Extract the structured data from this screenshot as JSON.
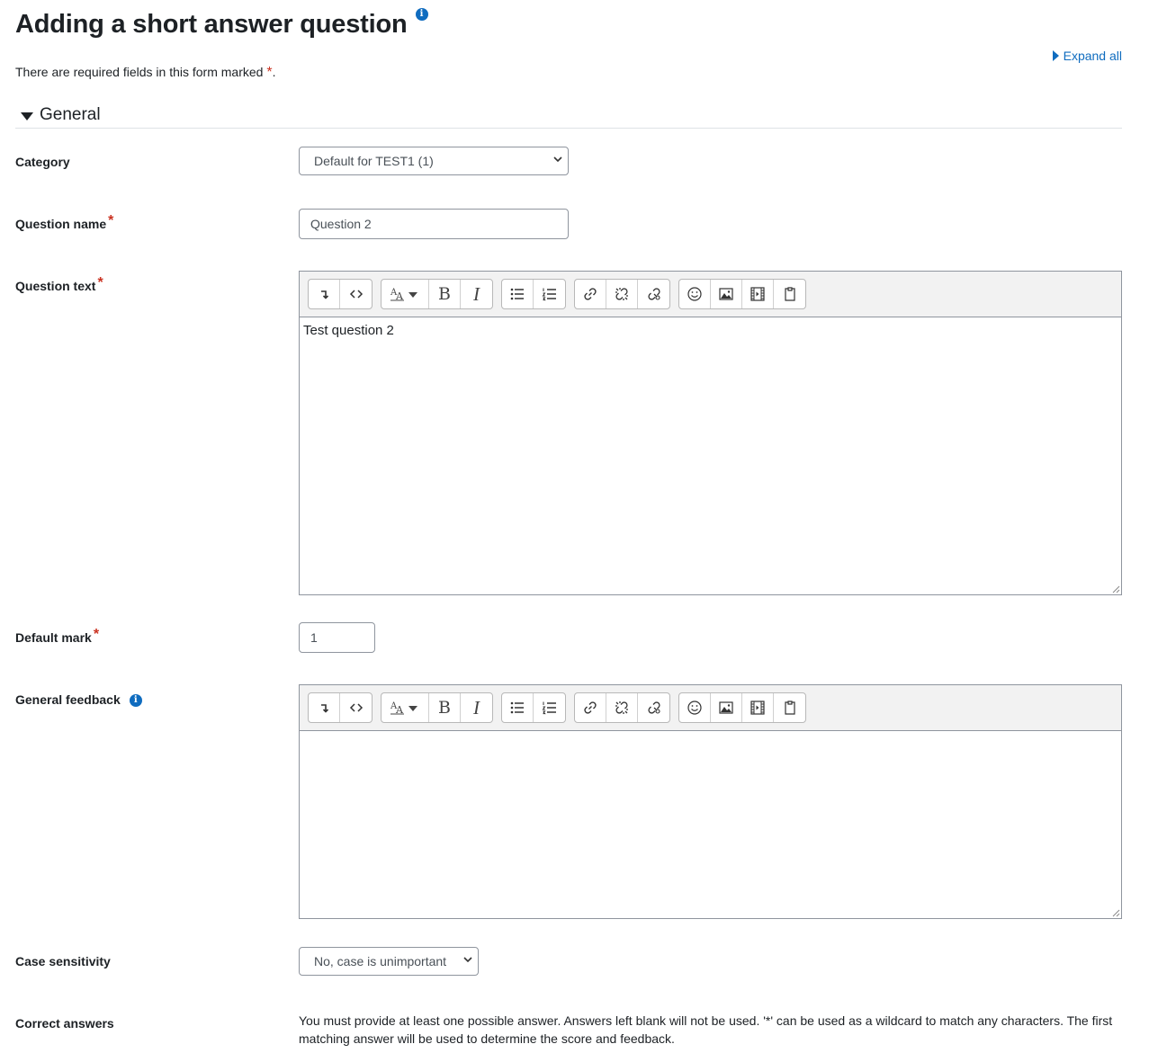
{
  "header": {
    "title": "Adding a short answer question",
    "help_icon": "info-icon",
    "expand_all": "Expand all",
    "required_note_prefix": "There are required fields in this form marked",
    "required_marker": "*",
    "required_note_suffix": "."
  },
  "section": {
    "title": "General",
    "state": "expanded"
  },
  "fields": {
    "category": {
      "label": "Category",
      "value": "Default for TEST1 (1)"
    },
    "question_name": {
      "label": "Question name",
      "value": "Question 2"
    },
    "question_text": {
      "label": "Question text",
      "value": "Test question 2"
    },
    "default_mark": {
      "label": "Default mark",
      "value": "1"
    },
    "general_feedback": {
      "label": "General feedback",
      "value": ""
    },
    "case_sensitivity": {
      "label": "Case sensitivity",
      "value": "No, case is unimportant"
    },
    "correct_answers": {
      "label": "Correct answers",
      "note": "You must provide at least one possible answer. Answers left blank will not be used. '*' can be used as a wildcard to match any characters. The first matching answer will be used to determine the score and feedback."
    }
  },
  "toolbar_icons": [
    [
      "collapse-icon",
      "html-icon"
    ],
    [
      "style-icon",
      "bold-icon",
      "italic-icon"
    ],
    [
      "bullet-list-icon",
      "numbered-list-icon"
    ],
    [
      "link-icon",
      "unlink-icon",
      "manage-files-icon"
    ],
    [
      "emoticon-icon",
      "image-icon",
      "media-icon",
      "paste-icon"
    ]
  ],
  "toolbar_glyphs": {
    "bold": "B",
    "italic": "I"
  },
  "colors": {
    "link": "#0f6cbf",
    "required": "#ca3120",
    "text": "#1d2125",
    "toolbar_bg": "#f2f2f2"
  }
}
